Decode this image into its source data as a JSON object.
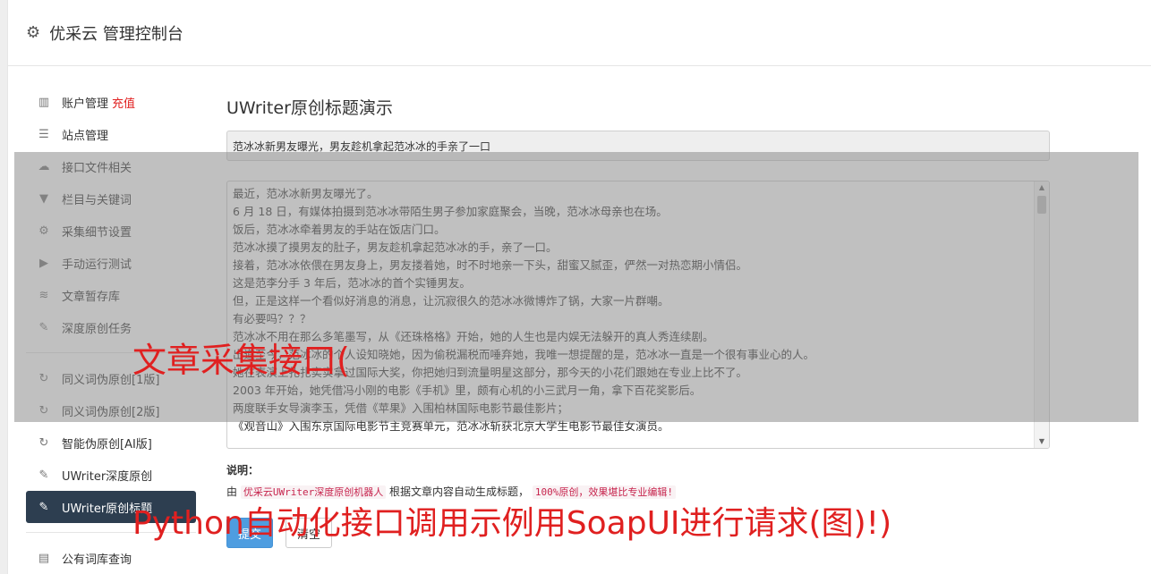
{
  "header": {
    "title": "优采云 管理控制台",
    "icon": "gear-icon"
  },
  "sidebar": {
    "group1": [
      {
        "label": "账户管理",
        "extra": "充值",
        "icon": "bar-chart-icon"
      },
      {
        "label": "站点管理",
        "icon": "server-icon"
      },
      {
        "label": "接口文件相关",
        "icon": "cloud-upload-icon"
      },
      {
        "label": "栏目与关键词",
        "icon": "filter-icon"
      },
      {
        "label": "采集细节设置",
        "icon": "gears-icon"
      },
      {
        "label": "手动运行测试",
        "icon": "play-circle-icon"
      },
      {
        "label": "文章暂存库",
        "icon": "database-icon"
      },
      {
        "label": "深度原创任务",
        "icon": "edit-icon"
      }
    ],
    "group2": [
      {
        "label": "同义词伪原创[1版]",
        "icon": "refresh-icon"
      },
      {
        "label": "同义词伪原创[2版]",
        "icon": "refresh-icon"
      },
      {
        "label": "智能伪原创[AI版]",
        "icon": "refresh-icon"
      },
      {
        "label": "UWriter深度原创",
        "icon": "edit-icon"
      },
      {
        "label": "UWriter原创标题",
        "icon": "edit-icon",
        "active": true
      }
    ],
    "group3": [
      {
        "label": "公有词库查询",
        "icon": "book-icon"
      }
    ]
  },
  "main": {
    "heading": "UWriter原创标题演示",
    "title_value": "范冰冰新男友曝光，男友趁机拿起范冰冰的手亲了一口",
    "content_lines": [
      "最近，范冰冰新男友曝光了。",
      "6 月 18 日，有媒体拍摄到范冰冰带陌生男子参加家庭聚会，当晚，范冰冰母亲也在场。",
      "饭后，范冰冰牵着男友的手站在饭店门口。",
      "范冰冰摸了摸男友的肚子，男友趁机拿起范冰冰的手，亲了一口。",
      "接着，范冰冰依偎在男友身上，男友搂着她，时不时地亲一下头，甜蜜又腻歪，俨然一对热恋期小情侣。",
      "这是范李分手 3 年后，范冰冰的首个实锤男友。",
      "但，正是这样一个看似好消息的消息，让沉寂很久的范冰冰微博炸了锅，大家一片群嘲。",
      "有必要吗？？？",
      "范冰冰不用在那么多笔墨写，从《还珠格格》开始，她的人生也是内娱无法躲开的真人秀连续剧。",
      "出道至今，范冰冰的个人设知晓她，因为偷税漏税而唾弃她，我唯一想提醒的是，范冰冰一直是一个很有事业心的人。",
      "她在表演上扎扎实实拿过国际大奖，你把她归到流量明星这部分，那今天的小花们跟她在专业上比不了。",
      "2003 年开始，她凭借冯小刚的电影《手机》里，颇有心机的小三武月一角，拿下百花奖影后。",
      "两度联手女导演李玉，凭借《苹果》入围柏林国际电影节最佳影片；",
      "《观音山》入围东京国际电影节主竞赛单元，范冰冰斩获北京大学生电影节最佳女演员。"
    ],
    "note_label": "说明：",
    "note_prefix": "由",
    "note_code1": "优采云UWriter深度原创机器人",
    "note_middle": "根据文章内容自动生成标题，",
    "note_code2": "100%原创，效果堪比专业编辑!",
    "submit_label": "提交",
    "clear_label": "清空"
  },
  "watermark": {
    "line1": "文章采集接口(",
    "line2": "Python自动化接口调用示例用SoapUI进行请求(图)!)"
  }
}
